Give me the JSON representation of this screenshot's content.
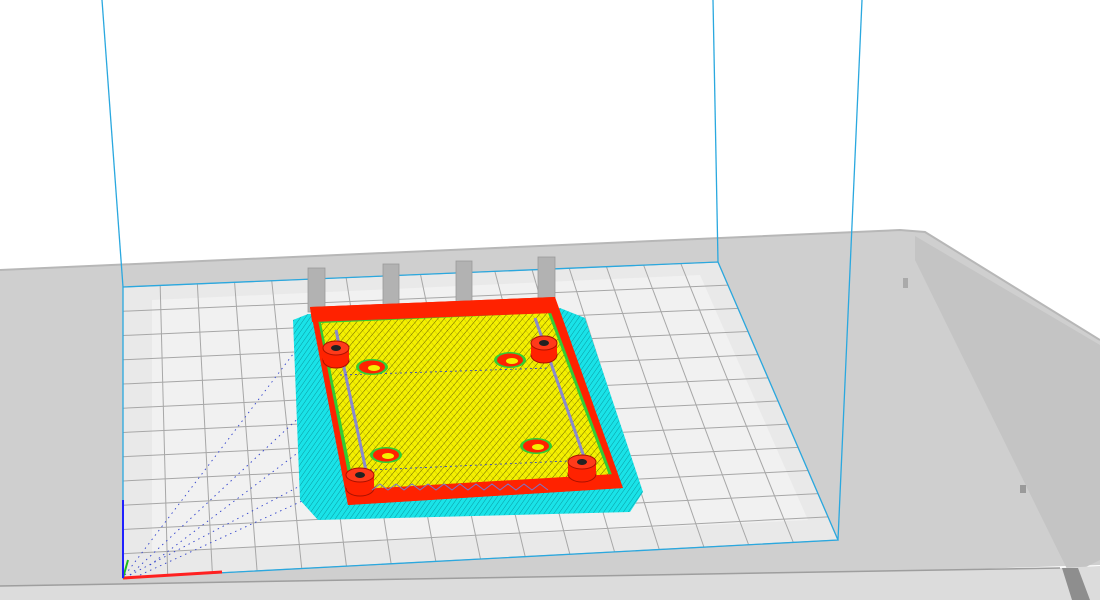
{
  "viewport": {
    "view": "3d-layer-preview",
    "colors": {
      "background": "#ffffff",
      "build_volume_outline": "#2aa8df",
      "platform": "#cfcfcf",
      "platform_edge": "#b7b7b7",
      "bed_surface": "#e9e9e9",
      "bed_grid": "#a7a7a7",
      "skirt": "#19e3e8",
      "wall_outer": "#ff2200",
      "infill_top": "#f4f000",
      "infill_line": "#5a5400",
      "inner_wall": "#33cc33",
      "support": "#b2b2b2",
      "travel": "#3344cc",
      "axis_x": "#ff2020",
      "axis_y": "#20bb20",
      "axis_z": "#2020ff"
    },
    "icons": {
      "x_axis": "axis-x-icon",
      "y_axis": "axis-y-icon",
      "z_axis": "axis-z-icon"
    }
  }
}
